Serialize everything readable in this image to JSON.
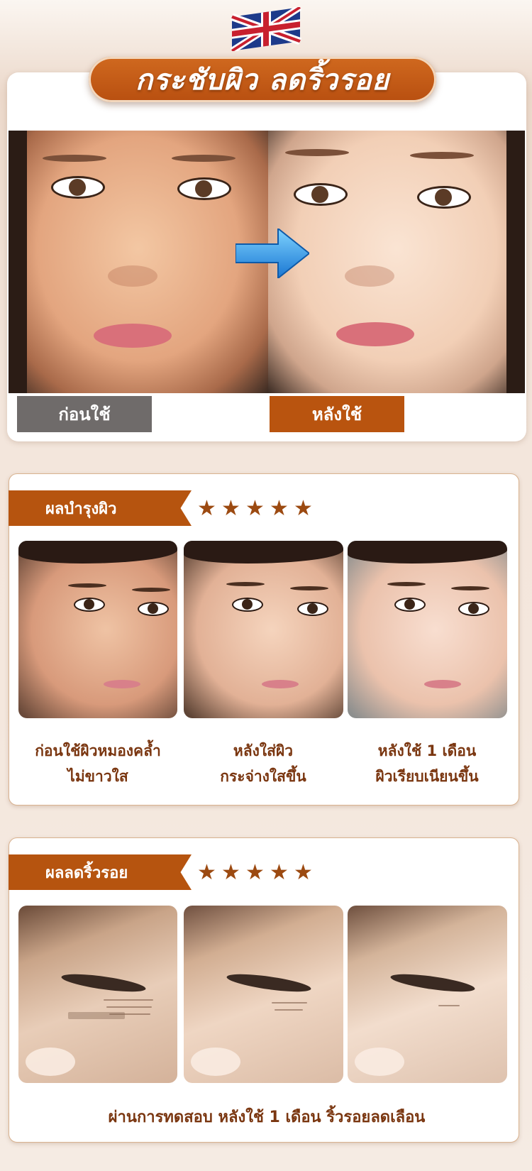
{
  "header": {
    "flag_icon": "uk-flag-icon",
    "title": "กระชับผิว ลดริ้วรอย"
  },
  "before_after": {
    "before_label": "ก่อนใช้",
    "after_label": "หลังใช้",
    "arrow_icon": "arrow-right-icon"
  },
  "section_skin": {
    "tag": "ผลบำรุงผิว",
    "rating": 5,
    "captions": [
      {
        "line1": "ก่อนใช้ผิวหมองคล้ำ",
        "line2": "ไม่ขาวใส"
      },
      {
        "line1": "หลังใส่ผิว",
        "line2": "กระจ่างใสขึ้น"
      },
      {
        "line1": "หลังใช้ 1 เดือน",
        "line2": "ผิวเรียบเนียนขึ้น"
      }
    ]
  },
  "section_wrinkle": {
    "tag": "ผลลดริ้วรอย",
    "rating": 5,
    "caption": "ผ่านการทดสอบ หลังใช้ 1 เดือน ริ้วรอยลดเลือน"
  },
  "colors": {
    "accent": "#b6540f",
    "caption_text": "#7a3610",
    "star": "#9c4a11",
    "before_label_bg": "#6f6b6a"
  }
}
